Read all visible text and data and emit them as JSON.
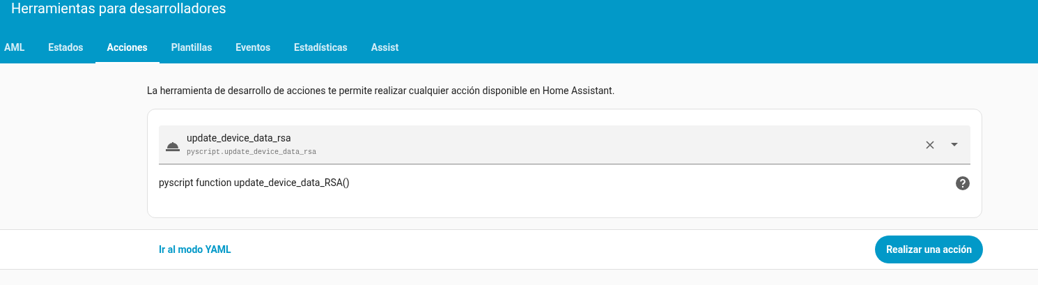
{
  "header": {
    "title": "Herramientas para desarrolladores"
  },
  "tabs": [
    {
      "label": "AML",
      "selected": false
    },
    {
      "label": "Estados",
      "selected": false
    },
    {
      "label": "Acciones",
      "selected": true
    },
    {
      "label": "Plantillas",
      "selected": false
    },
    {
      "label": "Eventos",
      "selected": false
    },
    {
      "label": "Estadísticas",
      "selected": false
    },
    {
      "label": "Assist",
      "selected": false
    }
  ],
  "description": "La herramienta de desarrollo de acciones te permite realizar cualquier acción disponible en Home Assistant.",
  "action_picker": {
    "name": "update_device_data_rsa",
    "id": "pyscript.update_device_data_rsa"
  },
  "action_description": "pyscript function update_device_data_RSA()",
  "footer": {
    "link": "Ir al modo YAML",
    "button": "Realizar una acción"
  }
}
